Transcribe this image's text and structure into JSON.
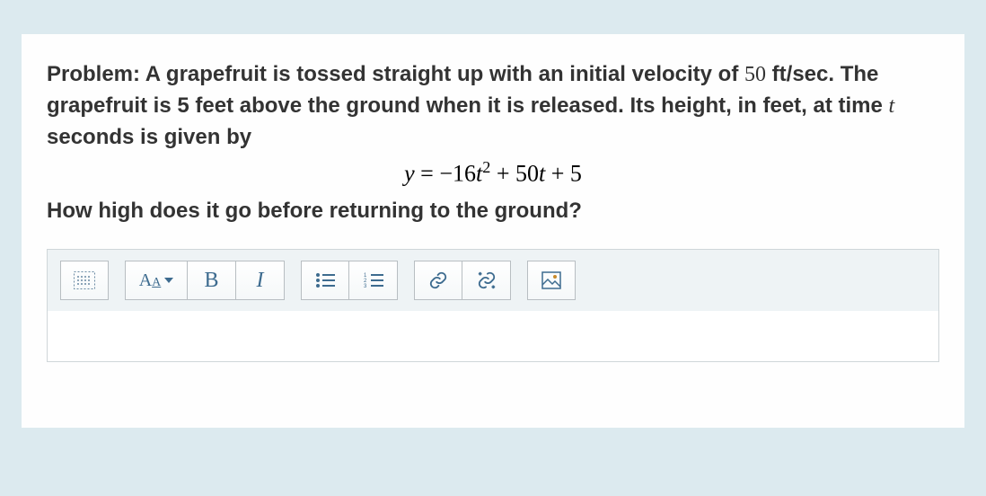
{
  "problem": {
    "label": "Problem:",
    "text_before_velocity": " A grapefruit is tossed straight up with an initial velocity of ",
    "velocity": "50",
    "text_after_velocity": " ft/sec. The grapefruit is 5 feet above the ground when it is released. Its height, in feet, at time ",
    "time_var": "t",
    "text_after_t": " seconds is given by"
  },
  "equation": {
    "raw": "y = -16t^2 + 50t + 5",
    "y": "y",
    "eq": " = ",
    "minus": "−",
    "a": "16",
    "t1": "t",
    "sq": "2",
    "plus1": " + ",
    "b": "50",
    "t2": "t",
    "plus2": " + ",
    "c": "5"
  },
  "question": "How high does it go before returning to the ground?",
  "toolbar": {
    "font_big": "A",
    "font_small": "A",
    "bold": "B",
    "italic": "I"
  }
}
